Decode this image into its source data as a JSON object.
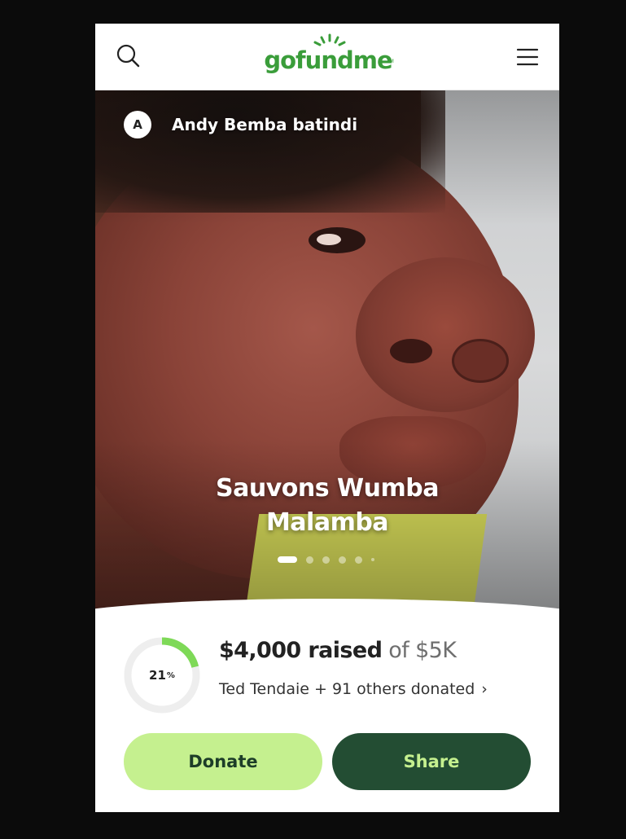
{
  "header": {
    "logo_text": "gofundme",
    "logo_tm": "TM",
    "search_icon": "search-icon",
    "menu_icon": "hamburger-menu-icon",
    "brand_color": "#3a9d3a"
  },
  "hero": {
    "organizer_initial": "A",
    "organizer_name": "Andy Bemba batindi",
    "title_line1": "Sauvons Wumba",
    "title_line2": "Malamba",
    "carousel": {
      "total_dots": 7,
      "active_index": 0
    }
  },
  "fundraiser": {
    "progress_percent": 21,
    "progress_number": "21",
    "progress_unit": "%",
    "raised_amount": "$4,000 raised",
    "goal_text": "of $5K",
    "donors_text": "Ted Tendaie + 91 others donated",
    "donors_chevron": "›",
    "progress_color": "#7ed957",
    "track_color": "#eeeeee"
  },
  "actions": {
    "donate_label": "Donate",
    "share_label": "Share",
    "donate_bg": "#c5f08f",
    "share_bg": "#234d33"
  }
}
